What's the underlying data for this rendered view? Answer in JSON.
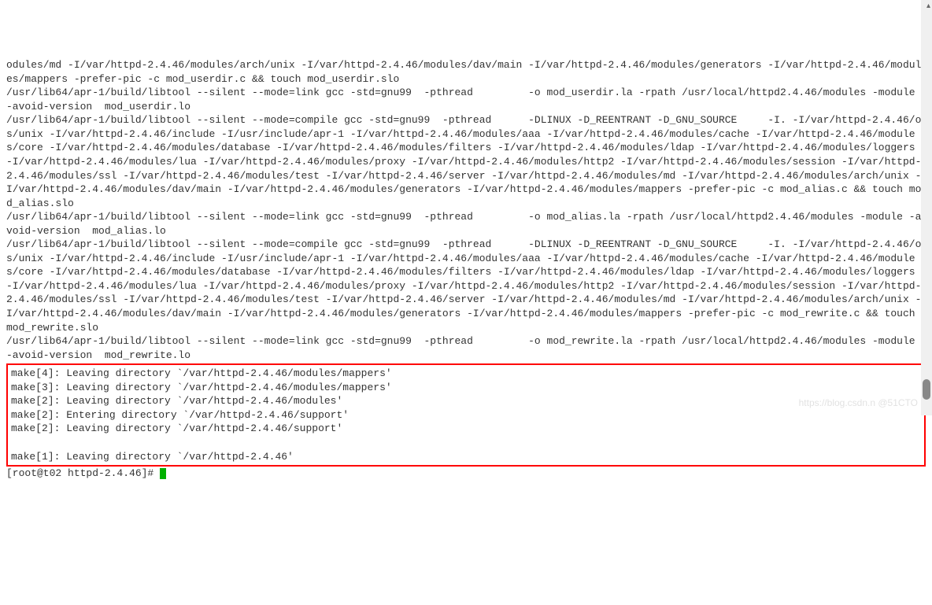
{
  "terminal": {
    "lines": [
      "odules/md -I/var/httpd-2.4.46/modules/arch/unix -I/var/httpd-2.4.46/modules/dav/main -I/var/httpd-2.4.46/modules/generators -I/var/httpd-2.4.46/modules/mappers -prefer-pic -c mod_userdir.c && touch mod_userdir.slo",
      "/usr/lib64/apr-1/build/libtool --silent --mode=link gcc -std=gnu99  -pthread         -o mod_userdir.la -rpath /usr/local/httpd2.4.46/modules -module -avoid-version  mod_userdir.lo",
      "/usr/lib64/apr-1/build/libtool --silent --mode=compile gcc -std=gnu99  -pthread      -DLINUX -D_REENTRANT -D_GNU_SOURCE     -I. -I/var/httpd-2.4.46/os/unix -I/var/httpd-2.4.46/include -I/usr/include/apr-1 -I/var/httpd-2.4.46/modules/aaa -I/var/httpd-2.4.46/modules/cache -I/var/httpd-2.4.46/modules/core -I/var/httpd-2.4.46/modules/database -I/var/httpd-2.4.46/modules/filters -I/var/httpd-2.4.46/modules/ldap -I/var/httpd-2.4.46/modules/loggers -I/var/httpd-2.4.46/modules/lua -I/var/httpd-2.4.46/modules/proxy -I/var/httpd-2.4.46/modules/http2 -I/var/httpd-2.4.46/modules/session -I/var/httpd-2.4.46/modules/ssl -I/var/httpd-2.4.46/modules/test -I/var/httpd-2.4.46/server -I/var/httpd-2.4.46/modules/md -I/var/httpd-2.4.46/modules/arch/unix -I/var/httpd-2.4.46/modules/dav/main -I/var/httpd-2.4.46/modules/generators -I/var/httpd-2.4.46/modules/mappers -prefer-pic -c mod_alias.c && touch mod_alias.slo",
      "/usr/lib64/apr-1/build/libtool --silent --mode=link gcc -std=gnu99  -pthread         -o mod_alias.la -rpath /usr/local/httpd2.4.46/modules -module -avoid-version  mod_alias.lo",
      "/usr/lib64/apr-1/build/libtool --silent --mode=compile gcc -std=gnu99  -pthread      -DLINUX -D_REENTRANT -D_GNU_SOURCE     -I. -I/var/httpd-2.4.46/os/unix -I/var/httpd-2.4.46/include -I/usr/include/apr-1 -I/var/httpd-2.4.46/modules/aaa -I/var/httpd-2.4.46/modules/cache -I/var/httpd-2.4.46/modules/core -I/var/httpd-2.4.46/modules/database -I/var/httpd-2.4.46/modules/filters -I/var/httpd-2.4.46/modules/ldap -I/var/httpd-2.4.46/modules/loggers -I/var/httpd-2.4.46/modules/lua -I/var/httpd-2.4.46/modules/proxy -I/var/httpd-2.4.46/modules/http2 -I/var/httpd-2.4.46/modules/session -I/var/httpd-2.4.46/modules/ssl -I/var/httpd-2.4.46/modules/test -I/var/httpd-2.4.46/server -I/var/httpd-2.4.46/modules/md -I/var/httpd-2.4.46/modules/arch/unix -I/var/httpd-2.4.46/modules/dav/main -I/var/httpd-2.4.46/modules/generators -I/var/httpd-2.4.46/modules/mappers -prefer-pic -c mod_rewrite.c && touch mod_rewrite.slo",
      "/usr/lib64/apr-1/build/libtool --silent --mode=link gcc -std=gnu99  -pthread         -o mod_rewrite.la -rpath /usr/local/httpd2.4.46/modules -module -avoid-version  mod_rewrite.lo"
    ],
    "highlighted_lines": [
      "make[4]: Leaving directory `/var/httpd-2.4.46/modules/mappers'",
      "make[3]: Leaving directory `/var/httpd-2.4.46/modules/mappers'",
      "make[2]: Leaving directory `/var/httpd-2.4.46/modules'",
      "make[2]: Entering directory `/var/httpd-2.4.46/support'",
      "make[2]: Leaving directory `/var/httpd-2.4.46/support'",
      "",
      "make[1]: Leaving directory `/var/httpd-2.4.46'"
    ],
    "prompt": "[root@t02 httpd-2.4.46]# "
  },
  "watermark": "https://blog.csdn.n @51CTO"
}
